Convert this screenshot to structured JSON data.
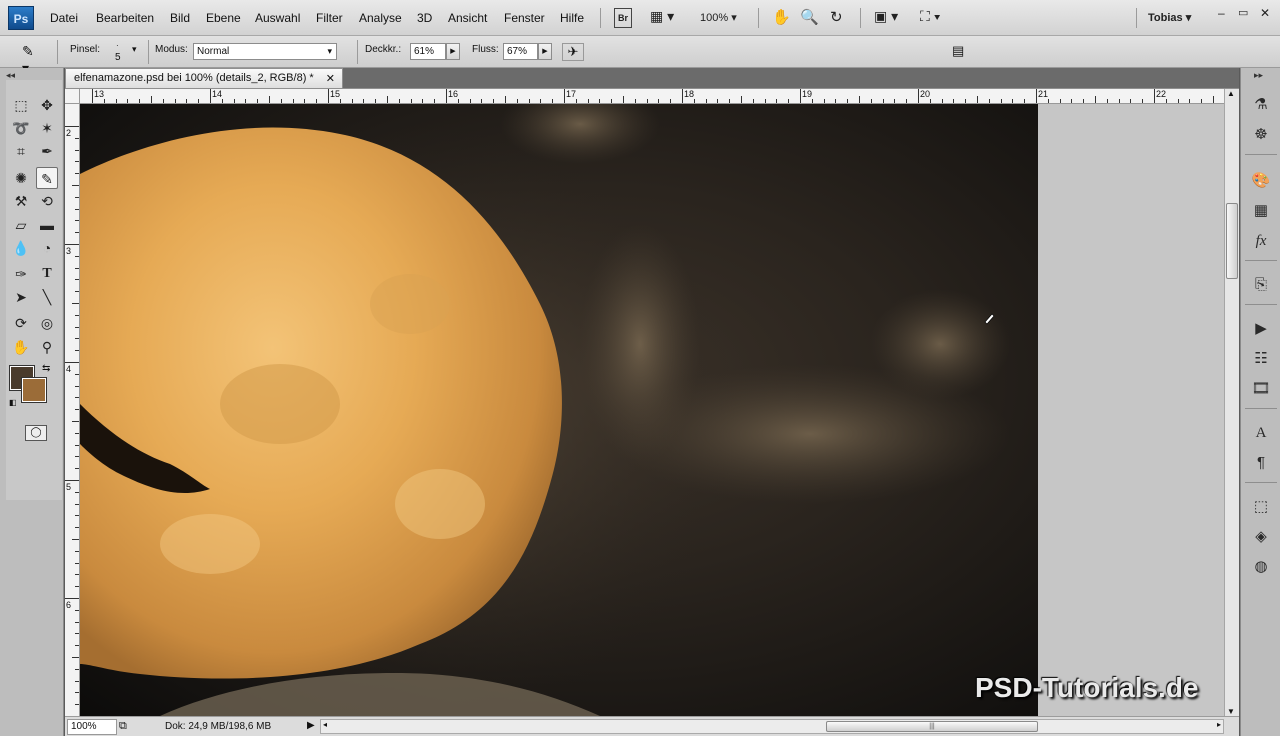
{
  "app": {
    "logo": "Ps"
  },
  "menu": [
    "Datei",
    "Bearbeiten",
    "Bild",
    "Ebene",
    "Auswahl",
    "Filter",
    "Analyse",
    "3D",
    "Ansicht",
    "Fenster",
    "Hilfe"
  ],
  "menubar": {
    "bridge": "Br",
    "zoom": "100%",
    "user": "Tobias"
  },
  "options": {
    "brush_label": "Pinsel:",
    "brush_size": "5",
    "mode_label": "Modus:",
    "mode_value": "Normal",
    "opacity_label": "Deckkr.:",
    "opacity_value": "61%",
    "flow_label": "Fluss:",
    "flow_value": "67%"
  },
  "document": {
    "tab_title": "elfenamazone.psd bei 100% (details_2, RGB/8) *",
    "ruler_top": [
      "13",
      "14",
      "15",
      "16",
      "17",
      "18",
      "19",
      "20",
      "21",
      "22"
    ],
    "ruler_left": [
      "2",
      "3",
      "4",
      "5",
      "6"
    ],
    "moon_color": "#e6aa55"
  },
  "status": {
    "zoom": "100%",
    "doc_info": "Dok: 24,9 MB/198,6 MB"
  },
  "watermark": "PSD-Tutorials.de",
  "colors": {
    "foreground": "#4a3b2c",
    "background": "#9b6c38"
  }
}
